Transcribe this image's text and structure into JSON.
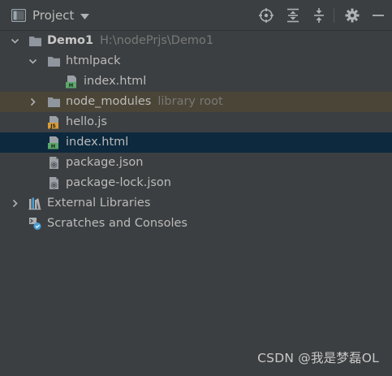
{
  "panel": {
    "title": "Project"
  },
  "toolbar": {
    "icons": [
      "locate-icon",
      "expand-all-icon",
      "collapse-all-icon",
      "gear-icon",
      "minimize-icon"
    ]
  },
  "tree": {
    "root_name": "Demo1",
    "root_path": "H:\\nodePrjs\\Demo1",
    "htmlpack": "htmlpack",
    "htmlpack_index": "index.html",
    "node_modules": "node_modules",
    "node_modules_hint": "library root",
    "hello": "hello.js",
    "index": "index.html",
    "package": "package.json",
    "package_lock": "package-lock.json",
    "external_libraries": "External Libraries",
    "scratches": "Scratches and Consoles"
  },
  "colors": {
    "background": "#3c3f41",
    "selected_row": "#0d293e",
    "excluded_row": "#4a4536",
    "folder": "#8f969e",
    "html_badge": "#59a869",
    "js_badge": "#d79d3a"
  },
  "watermark": "CSDN @我是梦磊OL"
}
